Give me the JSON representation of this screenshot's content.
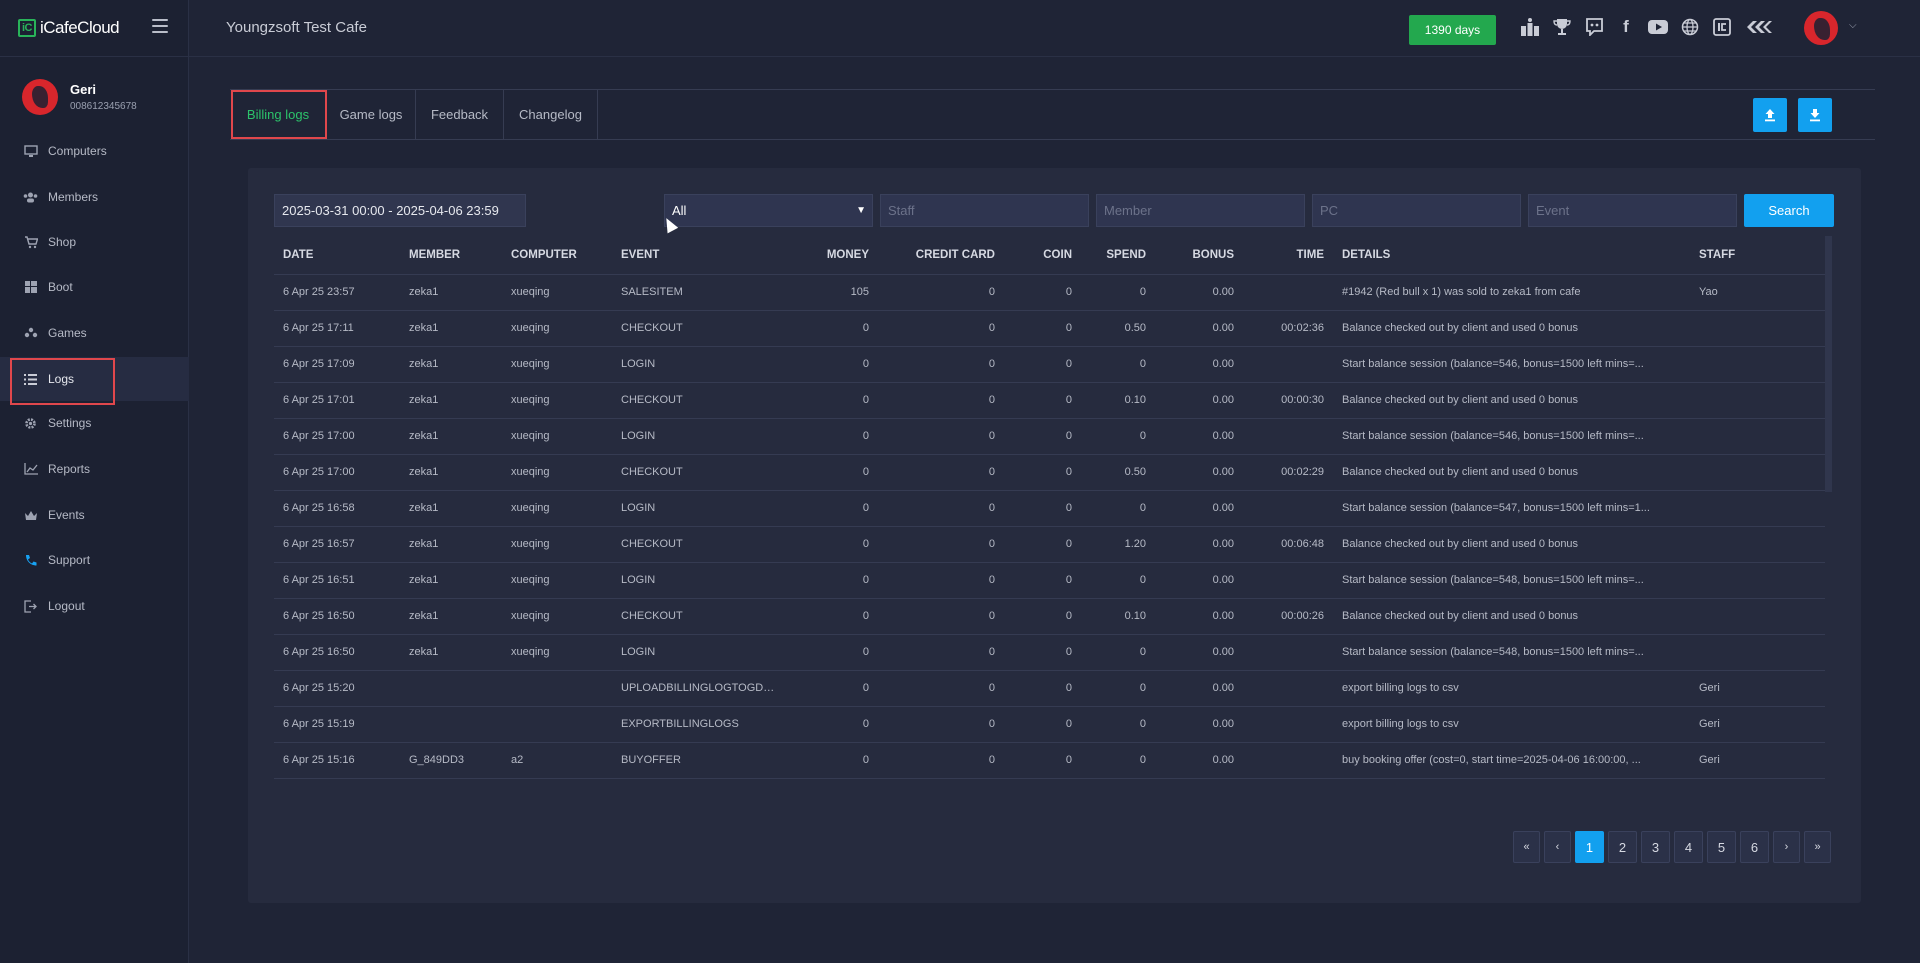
{
  "app": {
    "logo_text": "iCafeCloud",
    "logo_mark": "iC"
  },
  "profile": {
    "name": "Geri",
    "id": "008612345678"
  },
  "sidebar": {
    "items": [
      {
        "label": "Computers",
        "icon": "monitor-icon"
      },
      {
        "label": "Members",
        "icon": "users-icon"
      },
      {
        "label": "Shop",
        "icon": "cart-icon"
      },
      {
        "label": "Boot",
        "icon": "windows-icon"
      },
      {
        "label": "Games",
        "icon": "gamepad-icon"
      },
      {
        "label": "Logs",
        "icon": "list-icon"
      },
      {
        "label": "Settings",
        "icon": "gear-icon"
      },
      {
        "label": "Reports",
        "icon": "chart-icon"
      },
      {
        "label": "Events",
        "icon": "crown-icon"
      },
      {
        "label": "Support",
        "icon": "phone-icon"
      },
      {
        "label": "Logout",
        "icon": "logout-icon"
      }
    ]
  },
  "header": {
    "cafe_name": "Youngzsoft Test Cafe",
    "days_badge": "1390 days",
    "days_color": "#23a84e"
  },
  "tabs": [
    {
      "label": "Billing logs"
    },
    {
      "label": "Game logs"
    },
    {
      "label": "Feedback"
    },
    {
      "label": "Changelog"
    }
  ],
  "filters": {
    "date_range": "2025-03-31 00:00 - 2025-04-06 23:59",
    "type": "All",
    "staff_placeholder": "Staff",
    "member_placeholder": "Member",
    "pc_placeholder": "PC",
    "event_placeholder": "Event",
    "search_label": "Search"
  },
  "table": {
    "columns": [
      "DATE",
      "MEMBER",
      "COMPUTER",
      "EVENT",
      "MONEY",
      "CREDIT CARD",
      "COIN",
      "SPEND",
      "BONUS",
      "TIME",
      "DETAILS",
      "STAFF"
    ],
    "rows": [
      [
        "6 Apr 25 23:57",
        "zeka1",
        "xueqing",
        "SALESITEM",
        "105",
        "0",
        "0",
        "0",
        "0.00",
        "",
        "#1942 (Red bull x 1) was sold to zeka1 from cafe",
        "Yao"
      ],
      [
        "6 Apr 25 17:11",
        "zeka1",
        "xueqing",
        "CHECKOUT",
        "0",
        "0",
        "0",
        "0.50",
        "0.00",
        "00:02:36",
        "Balance checked out by client and used 0 bonus",
        ""
      ],
      [
        "6 Apr 25 17:09",
        "zeka1",
        "xueqing",
        "LOGIN",
        "0",
        "0",
        "0",
        "0",
        "0.00",
        "",
        "Start balance session (balance=546, bonus=1500 left mins=...",
        ""
      ],
      [
        "6 Apr 25 17:01",
        "zeka1",
        "xueqing",
        "CHECKOUT",
        "0",
        "0",
        "0",
        "0.10",
        "0.00",
        "00:00:30",
        "Balance checked out by client and used 0 bonus",
        ""
      ],
      [
        "6 Apr 25 17:00",
        "zeka1",
        "xueqing",
        "LOGIN",
        "0",
        "0",
        "0",
        "0",
        "0.00",
        "",
        "Start balance session (balance=546, bonus=1500 left mins=...",
        ""
      ],
      [
        "6 Apr 25 17:00",
        "zeka1",
        "xueqing",
        "CHECKOUT",
        "0",
        "0",
        "0",
        "0.50",
        "0.00",
        "00:02:29",
        "Balance checked out by client and used 0 bonus",
        ""
      ],
      [
        "6 Apr 25 16:58",
        "zeka1",
        "xueqing",
        "LOGIN",
        "0",
        "0",
        "0",
        "0",
        "0.00",
        "",
        "Start balance session (balance=547, bonus=1500 left mins=1...",
        ""
      ],
      [
        "6 Apr 25 16:57",
        "zeka1",
        "xueqing",
        "CHECKOUT",
        "0",
        "0",
        "0",
        "1.20",
        "0.00",
        "00:06:48",
        "Balance checked out by client and used 0 bonus",
        ""
      ],
      [
        "6 Apr 25 16:51",
        "zeka1",
        "xueqing",
        "LOGIN",
        "0",
        "0",
        "0",
        "0",
        "0.00",
        "",
        "Start balance session (balance=548, bonus=1500 left mins=...",
        ""
      ],
      [
        "6 Apr 25 16:50",
        "zeka1",
        "xueqing",
        "CHECKOUT",
        "0",
        "0",
        "0",
        "0.10",
        "0.00",
        "00:00:26",
        "Balance checked out by client and used 0 bonus",
        ""
      ],
      [
        "6 Apr 25 16:50",
        "zeka1",
        "xueqing",
        "LOGIN",
        "0",
        "0",
        "0",
        "0",
        "0.00",
        "",
        "Start balance session (balance=548, bonus=1500 left mins=...",
        ""
      ],
      [
        "6 Apr 25 15:20",
        "",
        "",
        "UPLOADBILLINGLOGTOGDRIVE",
        "0",
        "0",
        "0",
        "0",
        "0.00",
        "",
        "export billing logs to csv",
        "Geri"
      ],
      [
        "6 Apr 25 15:19",
        "",
        "",
        "EXPORTBILLINGLOGS",
        "0",
        "0",
        "0",
        "0",
        "0.00",
        "",
        "export billing logs to csv",
        "Geri"
      ],
      [
        "6 Apr 25 15:16",
        "G_849DD3",
        "a2",
        "BUYOFFER",
        "0",
        "0",
        "0",
        "0",
        "0.00",
        "",
        "buy booking offer (cost=0, start time=2025-04-06 16:00:00, ...",
        "Geri"
      ]
    ]
  },
  "pagination": {
    "first": "«",
    "prev": "‹",
    "pages": [
      "1",
      "2",
      "3",
      "4",
      "5",
      "6"
    ],
    "current": "1",
    "next": "›",
    "last": "»"
  },
  "colors": {
    "accent": "#12a0ef",
    "active_tab": "#2cc36b",
    "highlight": "#e0474c"
  }
}
